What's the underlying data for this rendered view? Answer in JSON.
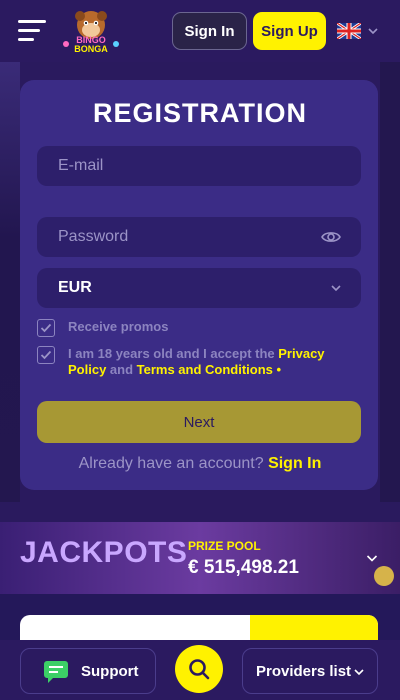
{
  "header": {
    "logo_text": "BINGO BONGA",
    "signin_label": "Sign In",
    "signup_label": "Sign Up",
    "language_icon": "uk-flag-icon"
  },
  "registration": {
    "title": "REGISTRATION",
    "email_placeholder": "E-mail",
    "password_placeholder": "Password",
    "currency_value": "EUR",
    "receive_promos": {
      "label": "Receive promos",
      "checked": true
    },
    "terms": {
      "checked": true,
      "text_prefix": "I am 18 years old and I accept the ",
      "privacy_link": "Privacy Policy",
      "and_text": " and ",
      "terms_link": "Terms and Conditions",
      "required_mark": " •"
    },
    "next_label": "Next",
    "already_text": "Already have an account?",
    "signin_link": "Sign In"
  },
  "jackpots": {
    "title": "JACKPOTS",
    "prize_label": "PRIZE POOL",
    "amount": "€ 515,498.21"
  },
  "bottom_bar": {
    "support_label": "Support",
    "providers_label": "Providers list"
  },
  "colors": {
    "background": "#2b1a60",
    "card": "#3b2c86",
    "accent_yellow": "#fff200",
    "next_button": "#a79834"
  }
}
